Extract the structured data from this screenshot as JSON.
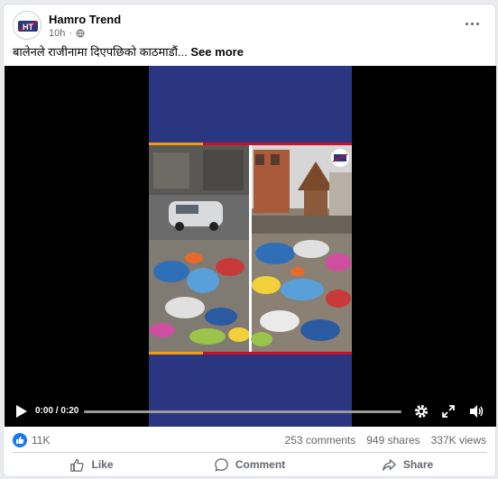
{
  "post": {
    "page_name": "Hamro Trend",
    "time": "10h",
    "text": "बालेनले राजीनामा दिएपछिको काठमाडौं...",
    "see_more": "See more",
    "logo_letters": "HT"
  },
  "video": {
    "time": "0:00 / 0:20",
    "progress": 0,
    "icons": [
      "play-icon",
      "settings-icon",
      "fullscreen-icon",
      "volume-icon"
    ]
  },
  "stats": {
    "likes": "11K",
    "comments": "253 comments",
    "shares": "949 shares",
    "views": "337K views"
  },
  "actions": {
    "like": "Like",
    "comment": "Comment",
    "share": "Share"
  },
  "colors": {
    "accent": "#1877f2",
    "video_bg": "#2a367f",
    "banner_red": "#c8102e",
    "banner_orange": "#f39c12"
  }
}
